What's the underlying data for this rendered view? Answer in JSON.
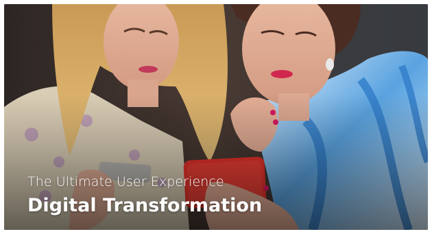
{
  "hero": {
    "subtitle": "The Ultimate User Experience",
    "title": "Digital Transformation",
    "image_icon": "photo-two-women-looking-at-phone"
  },
  "colors": {
    "text": "#ffffff",
    "phone_accent": "#e8322b",
    "shirt_accent": "#3f8fd6"
  }
}
